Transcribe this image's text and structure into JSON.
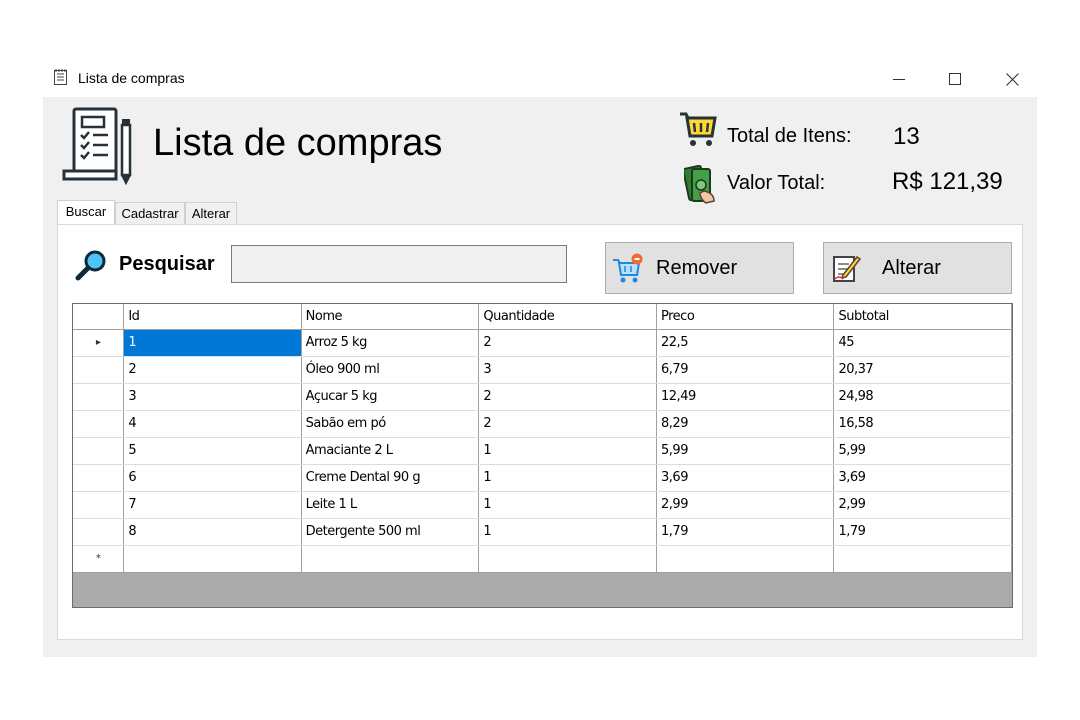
{
  "window": {
    "title": "Lista de compras",
    "controls": [
      "minimize-icon",
      "maximize-icon",
      "close-icon"
    ]
  },
  "header": {
    "title": "Lista de compras",
    "icon": "shopping-list-icon"
  },
  "summary": {
    "total_items_label": "Total de Itens:",
    "total_items_value": "13",
    "total_value_label": "Valor Total:",
    "total_value_value": "R$ 121,39"
  },
  "tabs": [
    {
      "label": "Buscar",
      "active": true
    },
    {
      "label": "Cadastrar",
      "active": false
    },
    {
      "label": "Alterar",
      "active": false
    }
  ],
  "search": {
    "label": "Pesquisar",
    "value": "",
    "placeholder": ""
  },
  "buttons": {
    "remove_label": "Remover",
    "alter_label": "Alterar"
  },
  "grid": {
    "current_row_marker": "▸",
    "new_row_marker": "*",
    "columns": [
      "Id",
      "Nome",
      "Quantidade",
      "Preco",
      "Subtotal"
    ],
    "rows": [
      [
        "1",
        "Arroz 5 kg",
        "2",
        "22,5",
        "45"
      ],
      [
        "2",
        "Óleo 900 ml",
        "3",
        "6,79",
        "20,37"
      ],
      [
        "3",
        "Açucar 5 kg",
        "2",
        "12,49",
        "24,98"
      ],
      [
        "4",
        "Sabão em pó",
        "2",
        "8,29",
        "16,58"
      ],
      [
        "5",
        "Amaciante 2 L",
        "1",
        "5,99",
        "5,99"
      ],
      [
        "6",
        "Creme Dental 90 g",
        "1",
        "3,69",
        "3,69"
      ],
      [
        "7",
        "Leite 1 L",
        "1",
        "2,99",
        "2,99"
      ],
      [
        "8",
        "Detergente 500 ml",
        "1",
        "1,79",
        "1,79"
      ]
    ]
  },
  "colors": {
    "window_bg": "#f0f0f0",
    "selection": "#0078d7",
    "grid_bg": "#ababab",
    "button_bg": "#e1e1e1"
  }
}
